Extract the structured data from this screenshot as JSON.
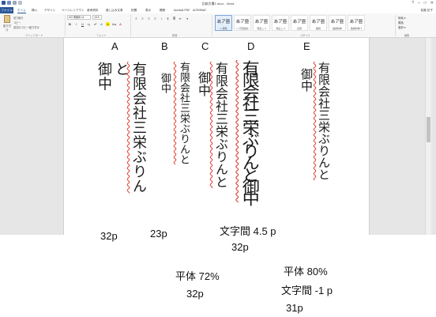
{
  "window": {
    "title": "比較文書1.docx - Word",
    "controls": [
      "?",
      "–",
      "□",
      "✕"
    ]
  },
  "tabs": {
    "file": "ファイル",
    "items": [
      "ホーム",
      "挿入",
      "デザイン",
      "ページレイアウト",
      "参考資料",
      "差し込み文書",
      "校閲",
      "表示",
      "開発",
      "Acrobat PDF",
      "ACROBAT"
    ],
    "user": "佐藤 花子"
  },
  "ribbon": {
    "clipboard": {
      "paste": "貼り付け",
      "cut": "切り取り",
      "copy": "コピー",
      "format_painter": "書式のコピー/貼り付け",
      "label": "クリップボード"
    },
    "font": {
      "name": "HG 明朝B Ut",
      "size": "18.5",
      "label": "フォント",
      "tools": [
        "B",
        "I",
        "U",
        "x₂",
        "x²",
        "A",
        "A",
        "Aa",
        "A"
      ]
    },
    "paragraph": {
      "label": "段落",
      "tools": [
        "≡",
        "≡",
        "≡",
        "≡",
        "↕",
        "¶",
        "≣",
        "⇤",
        "⇥"
      ]
    },
    "styles": {
      "label": "スタイル",
      "items": [
        {
          "sample": "あア亜",
          "name": "↵ 標準"
        },
        {
          "sample": "あア亜",
          "name": "↵ 行間詰め"
        },
        {
          "sample": "あア亜",
          "name": "見出し 1"
        },
        {
          "sample": "あア亜",
          "name": "見出し 2"
        },
        {
          "sample": "あア亜",
          "name": "表題"
        },
        {
          "sample": "あア亜",
          "name": "副題"
        },
        {
          "sample": "あア亜",
          "name": "強調斜体"
        },
        {
          "sample": "あア亜",
          "name": "強調斜体 2"
        }
      ]
    },
    "editing": {
      "find": "検索 ▾",
      "replace": "置換",
      "select": "選択 ▾",
      "label": "編集"
    }
  },
  "columns": {
    "a": {
      "label": "A",
      "lines": [
        "有限会社三栄ぶりん",
        "と",
        "御中"
      ]
    },
    "b": {
      "label": "B",
      "lines": [
        "有限会社三栄ぶりんと",
        "御中"
      ]
    },
    "c": {
      "label": "C",
      "lines": [
        "有限会社三栄ぶりんと",
        "御中"
      ]
    },
    "d": {
      "label": "D",
      "lines": [
        "有限会社三栄ぶりんと御中"
      ]
    },
    "e": {
      "label": "E",
      "lines": [
        "有限会社三栄ぶりんと",
        "御中"
      ]
    }
  },
  "annotations": {
    "a_size": "32p",
    "b_size": "23p",
    "c_spacing": "文字間 4.5 p",
    "c_size": "32p",
    "b_scale": "平体 72%",
    "b_scale_size": "32p",
    "e_scale": "平体 80%",
    "e_spacing": "文字間 -1 p",
    "e_size": "31p"
  },
  "colors": {
    "accent": "#2b579a",
    "spellcheck": "#e0392b"
  }
}
